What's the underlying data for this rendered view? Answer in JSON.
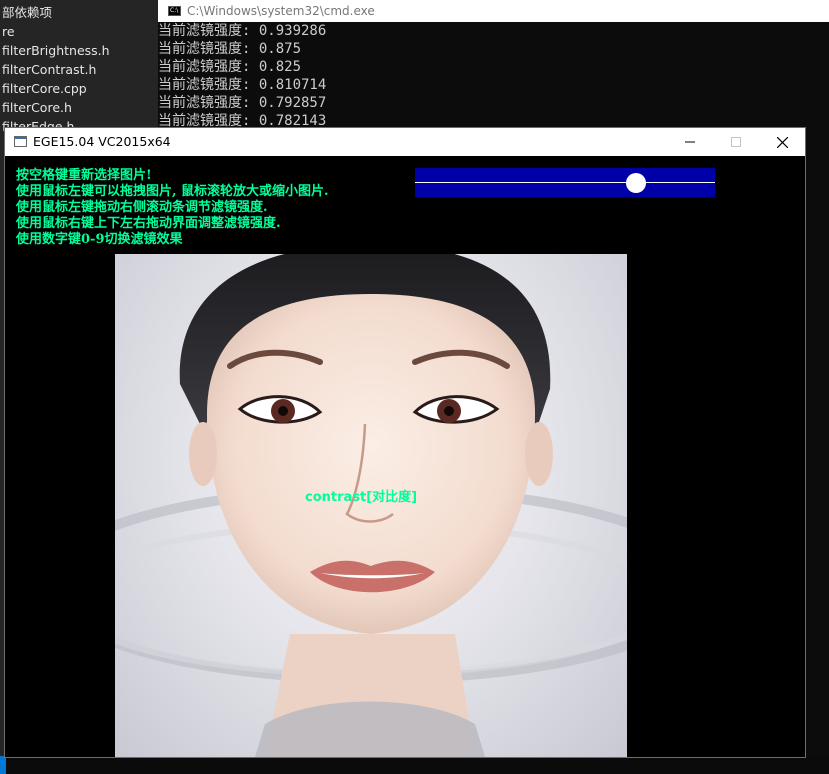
{
  "ide": {
    "items": [
      "部依赖项",
      "re",
      "filterBrightness.h",
      "filterContrast.h",
      "filterCore.cpp",
      "filterCore.h",
      "filterEdge.h"
    ]
  },
  "cmd": {
    "title": "C:\\Windows\\system32\\cmd.exe",
    "lines": [
      "当前滤镜强度: 0.939286",
      "当前滤镜强度: 0.875",
      "当前滤镜强度: 0.825",
      "当前滤镜强度: 0.810714",
      "当前滤镜强度: 0.792857",
      "当前滤镜强度: 0.782143"
    ]
  },
  "ege": {
    "title": "EGE15.04 VC2015x64",
    "instructions": [
      "按空格键重新选择图片!",
      "使用鼠标左键可以拖拽图片, 鼠标滚轮放大或缩小图片.",
      "使用鼠标左键拖动右侧滚动条调节滤镜强度.",
      "使用鼠标右键上下左右拖动界面调整滤镜强度.",
      "使用数字键0-9切换滤镜效果"
    ],
    "filter_label": "contrast[对比度]",
    "slider": {
      "value": 0.782143
    },
    "colors": {
      "text": "#00ff99",
      "slider_track": "#0000a8",
      "background": "#000000"
    }
  },
  "icons": [
    "cmd-icon",
    "window-icon",
    "minimize-icon",
    "maximize-icon",
    "close-icon"
  ]
}
